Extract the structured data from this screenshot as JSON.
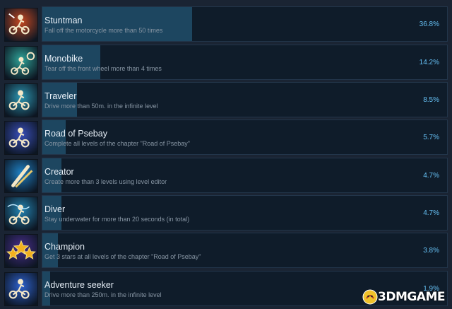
{
  "achievements": [
    {
      "title": "Stuntman",
      "desc": "Fall off the motorcycle more than 50 times",
      "pct": "36.8%",
      "rate": 0.368,
      "icon": "motorcycle-crash-icon",
      "bg": "#c94a22"
    },
    {
      "title": "Monobike",
      "desc": "Tear off the front wheel more than 4 times",
      "pct": "14.2%",
      "rate": 0.142,
      "icon": "monobike-icon",
      "bg": "#2fa59a"
    },
    {
      "title": "Traveler",
      "desc": "Drive more than 50m. in the infinite level",
      "pct": "8.5%",
      "rate": 0.085,
      "icon": "motorcycle-travel-icon",
      "bg": "#2d98b4"
    },
    {
      "title": "Road of Psebay",
      "desc": "Complete all levels of the chapter \"Road of Psebay\"",
      "pct": "5.7%",
      "rate": 0.057,
      "icon": "motorcycle-jump-icon",
      "bg": "#3a4fbb"
    },
    {
      "title": "Creator",
      "desc": "Create more than 3 levels using level editor",
      "pct": "4.7%",
      "rate": 0.047,
      "icon": "pencil-icon",
      "bg": "#1f82c7"
    },
    {
      "title": "Diver",
      "desc": "Stay underwater for more than 20 seconds (in total)",
      "pct": "4.7%",
      "rate": 0.047,
      "icon": "motorcycle-underwater-icon",
      "bg": "#2486b5"
    },
    {
      "title": "Champion",
      "desc": "Get 3 stars at all levels of the chapter \"Road of Psebay\"",
      "pct": "3.8%",
      "rate": 0.038,
      "icon": "three-stars-icon",
      "bg": "#4b2f8f"
    },
    {
      "title": "Adventure seeker",
      "desc": "Drive more than 250m. in the infinite level",
      "pct": "1.9%",
      "rate": 0.019,
      "icon": "motorcycle-wheelie-icon",
      "bg": "#2f62d0"
    }
  ],
  "watermark": {
    "text": "3DMGAME"
  }
}
